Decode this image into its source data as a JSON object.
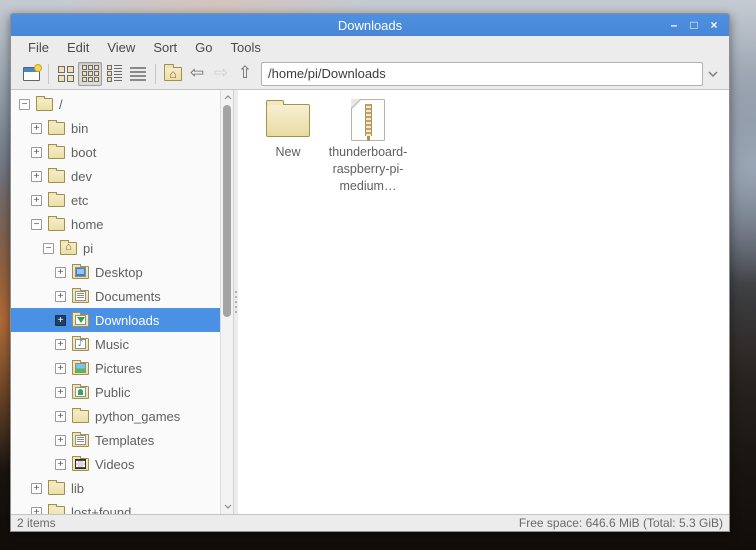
{
  "window": {
    "title": "Downloads",
    "controls": {
      "minimize": "–",
      "maximize": "□",
      "close": "×"
    }
  },
  "menu": {
    "items": [
      "File",
      "Edit",
      "View",
      "Sort",
      "Go",
      "Tools"
    ]
  },
  "toolbar": {
    "icons": [
      "new-window-icon",
      "icon-view-icon",
      "thumbnail-view-icon",
      "compact-view-icon",
      "detailed-list-view-icon",
      "home-folder-icon",
      "back-icon",
      "forward-icon",
      "up-icon"
    ],
    "active_view": "thumbnail-view",
    "back_glyph": "⇦",
    "forward_glyph": "⇨",
    "up_glyph": "⇧",
    "path_value": "/home/pi/Downloads",
    "house_glyph": "⌂"
  },
  "tree_glyphs": {
    "plus": "+",
    "minus": "−"
  },
  "sidebar": {
    "items": [
      {
        "label": "/",
        "level": 0,
        "expander": "minus",
        "icon": "folder"
      },
      {
        "label": "bin",
        "level": 1,
        "expander": "plus",
        "icon": "folder"
      },
      {
        "label": "boot",
        "level": 1,
        "expander": "plus",
        "icon": "folder"
      },
      {
        "label": "dev",
        "level": 1,
        "expander": "plus",
        "icon": "folder"
      },
      {
        "label": "etc",
        "level": 1,
        "expander": "plus",
        "icon": "folder"
      },
      {
        "label": "home",
        "level": 1,
        "expander": "minus",
        "icon": "folder"
      },
      {
        "label": "pi",
        "level": 2,
        "expander": "minus",
        "icon": "folder-home"
      },
      {
        "label": "Desktop",
        "level": 3,
        "expander": "plus",
        "icon": "folder-desktop"
      },
      {
        "label": "Documents",
        "level": 3,
        "expander": "plus",
        "icon": "folder-documents"
      },
      {
        "label": "Downloads",
        "level": 3,
        "expander": "plus",
        "icon": "folder-downloads",
        "selected": true
      },
      {
        "label": "Music",
        "level": 3,
        "expander": "plus",
        "icon": "folder-music"
      },
      {
        "label": "Pictures",
        "level": 3,
        "expander": "plus",
        "icon": "folder-pictures"
      },
      {
        "label": "Public",
        "level": 3,
        "expander": "plus",
        "icon": "folder-public"
      },
      {
        "label": "python_games",
        "level": 3,
        "expander": "plus",
        "icon": "folder"
      },
      {
        "label": "Templates",
        "level": 3,
        "expander": "plus",
        "icon": "folder-templates"
      },
      {
        "label": "Videos",
        "level": 3,
        "expander": "plus",
        "icon": "folder-videos"
      },
      {
        "label": "lib",
        "level": 1,
        "expander": "plus",
        "icon": "folder"
      },
      {
        "label": "lost+found",
        "level": 1,
        "expander": "plus",
        "icon": "folder"
      }
    ]
  },
  "main": {
    "items": [
      {
        "label": "New",
        "icon": "folder"
      },
      {
        "label": "thunderboard-raspberry-pi-medium…",
        "icon": "zip-file"
      }
    ]
  },
  "statusbar": {
    "left": "2 items",
    "right": "Free space: 646.6 MiB (Total: 5.3 GiB)"
  },
  "colors": {
    "titlebar": "#4a8ddb",
    "selection": "#4a90e5",
    "chrome": "#ececec",
    "folder": "#efe3b6"
  }
}
